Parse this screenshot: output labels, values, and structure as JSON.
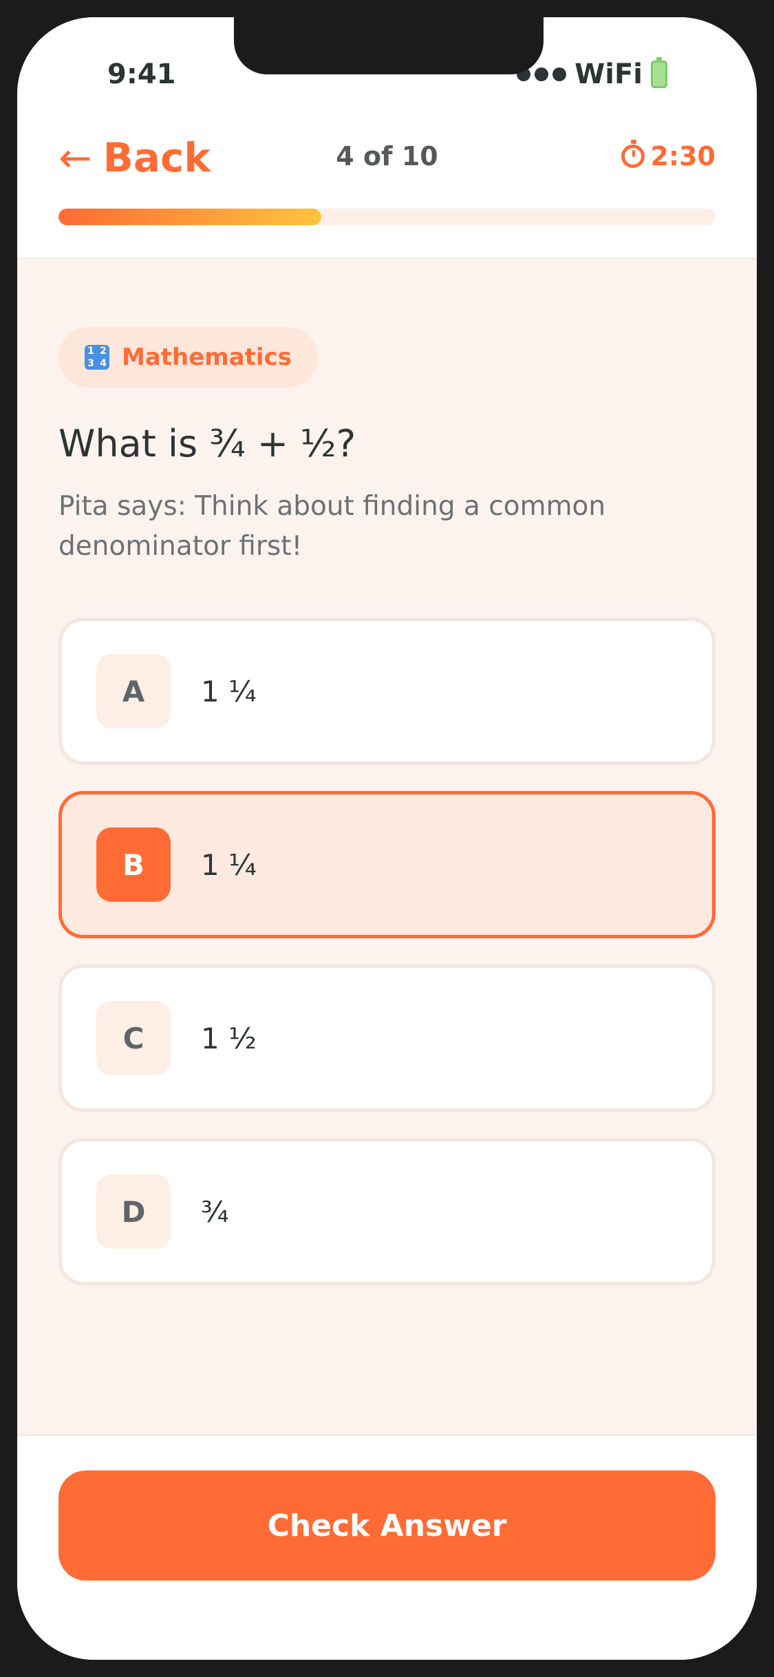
{
  "status_bar": {
    "time": "9:41",
    "wifi_label": "WiFi",
    "icons": [
      "signal-dots-icon",
      "battery-icon"
    ]
  },
  "header": {
    "back_arrow": "←",
    "back_label": "Back",
    "counter": "4 of 10",
    "timer": "2:30",
    "timer_icon": "stopwatch-icon",
    "progress_fraction": 0.4,
    "colors": {
      "accent": "#ff6b35",
      "progress_end": "#ffc43d"
    }
  },
  "question": {
    "subject": "Mathematics",
    "subject_icon": "numbers-icon",
    "subject_icon_glyphs": [
      "1",
      "2",
      "3",
      "4"
    ],
    "text": "What is ¾ + ½?",
    "hint": "Pita says: Think about finding a common denominator first!"
  },
  "options": [
    {
      "letter": "A",
      "text": "1 ¼",
      "selected": false
    },
    {
      "letter": "B",
      "text": "1 ¼",
      "selected": true
    },
    {
      "letter": "C",
      "text": "1 ½",
      "selected": false
    },
    {
      "letter": "D",
      "text": "¾",
      "selected": false
    }
  ],
  "footer": {
    "check_button_label": "Check Answer"
  }
}
